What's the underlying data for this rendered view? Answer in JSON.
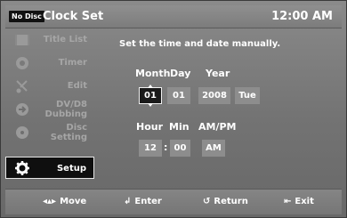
{
  "header": {
    "disc_status": "No Disc",
    "title": "Clock Set",
    "time": "12:00 AM"
  },
  "sidebar": {
    "items": [
      {
        "label": "Title List",
        "icon": "title-list-icon"
      },
      {
        "label": "Timer",
        "icon": "timer-icon"
      },
      {
        "label": "Edit",
        "icon": "scissors-icon"
      },
      {
        "label_line1": "DV/D8",
        "label_line2": "Dubbing",
        "icon": "dubbing-icon"
      },
      {
        "label_line1": "Disc",
        "label_line2": "Setting",
        "icon": "disc-icon"
      },
      {
        "label": "Setup",
        "icon": "gear-icon",
        "active": true
      }
    ]
  },
  "main": {
    "instruction": "Set the time and date manually.",
    "date_headers": {
      "month": "Month",
      "day": "Day",
      "year": "Year"
    },
    "date_values": {
      "month": "01",
      "day": "01",
      "year": "2008",
      "weekday": "Tue"
    },
    "time_headers": {
      "hour": "Hour",
      "min": "Min",
      "ampm": "AM/PM"
    },
    "time_values": {
      "hour": "12",
      "separator": ":",
      "min": "00",
      "ampm": "AM"
    }
  },
  "footer": {
    "move": "Move",
    "enter": "Enter",
    "return": "Return",
    "exit": "Exit"
  },
  "colors": {
    "selected_bg": "#1a1a1a",
    "field_bg": "#8d8d8d",
    "text": "#ffffff",
    "inactive_text": "#a6a6a6"
  }
}
